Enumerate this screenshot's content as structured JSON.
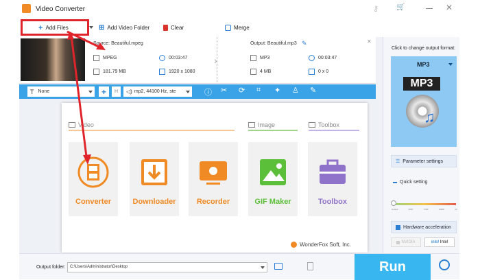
{
  "app": {
    "title": "Video Converter"
  },
  "toolbar": {
    "add_files": "Add Files",
    "add_video_folder": "Add Video Folder",
    "clear": "Clear",
    "merge": "Merge"
  },
  "file": {
    "source_name": "Source: Beautiful.mpeg",
    "output_name": "Output: Beautiful.mp3",
    "src_format": "MPEG",
    "src_duration": "00:03:47",
    "src_size": "181.79 MB",
    "src_resolution": "1920 x 1080",
    "out_format": "MP3",
    "out_duration": "00:03:47",
    "out_size": "4 MB",
    "out_resolution": "0 x 0"
  },
  "editbar": {
    "subtitle": "None",
    "audio_track": "mp2, 44100 Hz, ste"
  },
  "popup": {
    "section_video": "Video",
    "section_image": "Image",
    "section_toolbox": "Toolbox",
    "tiles": [
      "Converter",
      "Downloader",
      "Recorder",
      "GIF Maker",
      "Toolbox"
    ],
    "brand": "WonderFox Soft, Inc."
  },
  "right": {
    "change_format_label": "Click to change output format:",
    "format": "MP3",
    "format_icon_text": "MP3",
    "parameter_settings": "Parameter settings",
    "quick_setting": "Quick setting",
    "slider_labels": [
      "Default",
      "480P",
      "720P",
      "1080P",
      "4K"
    ],
    "hw_accel": "Hardware acceleration",
    "nvidia": "NVIDIA",
    "intel": "Intel"
  },
  "bottom": {
    "output_folder_label": "Output folder:",
    "output_folder_value": "C:\\Users\\Administrator\\Desktop",
    "run": "Run"
  },
  "colors": {
    "accent": "#3aa3e8",
    "run": "#38b6f0",
    "orange": "#f08a24",
    "green": "#5cbf3a",
    "purple": "#8f72c9",
    "highlight_red": "#e0242c"
  }
}
